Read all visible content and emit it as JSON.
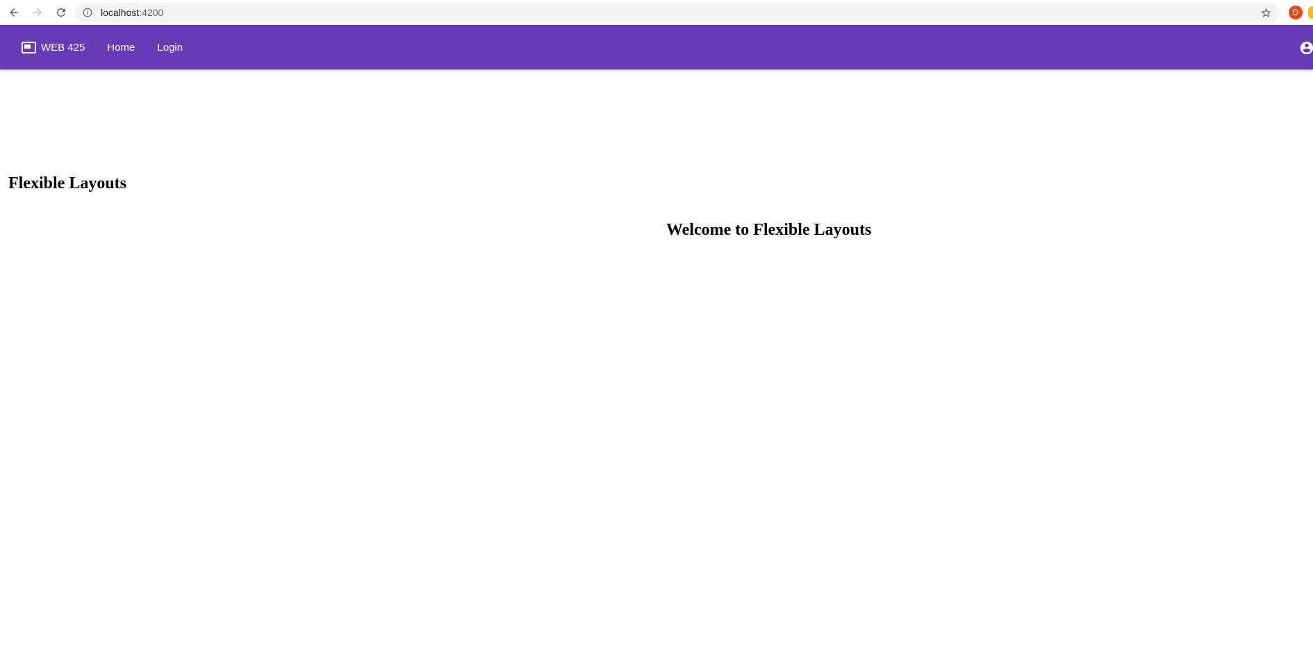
{
  "browser": {
    "url_host": "localhost",
    "url_port": ":4200",
    "profile_initial": "D",
    "icons": {
      "back": "arrow-left-icon",
      "forward": "arrow-right-icon",
      "reload": "reload-icon",
      "info": "info-icon",
      "bookmark": "star-icon"
    }
  },
  "toolbar": {
    "background_color": "#673ab7",
    "brand_icon": "featured-video-icon",
    "brand_label": "WEB 425",
    "nav": [
      {
        "label": "Home"
      },
      {
        "label": "Login"
      }
    ],
    "account_icon": "account-circle-icon"
  },
  "main": {
    "title": "Flexible Layouts",
    "welcome": "Welcome to Flexible Layouts"
  }
}
